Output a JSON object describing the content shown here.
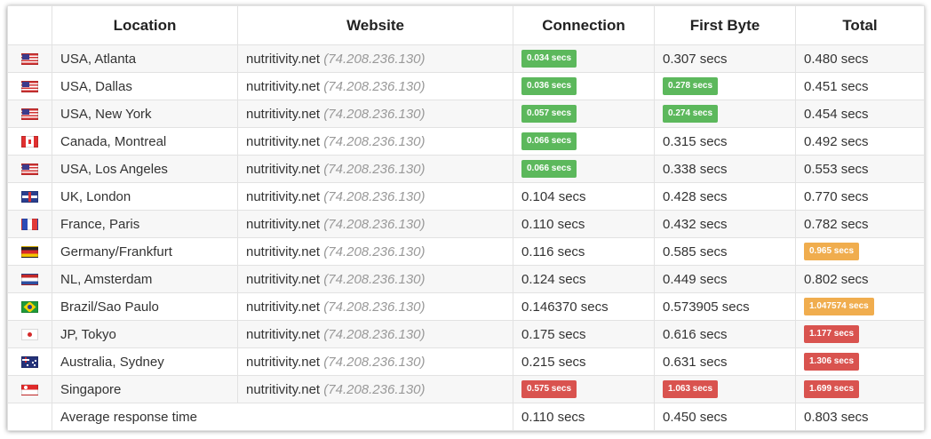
{
  "colors": {
    "green": "#5cb85c",
    "orange": "#f0ad4e",
    "red": "#d9534f"
  },
  "headers": {
    "flag": "",
    "location": "Location",
    "website": "Website",
    "connection": "Connection",
    "first_byte": "First Byte",
    "total": "Total"
  },
  "rows": [
    {
      "flag": "us",
      "flag_icon": "usa-flag-icon",
      "location": "USA, Atlanta",
      "site": "nutritivity.net",
      "ip": "(74.208.236.130)",
      "connection": {
        "value": "0.034 secs",
        "badge": "green"
      },
      "first_byte": {
        "value": "0.307 secs",
        "badge": ""
      },
      "total": {
        "value": "0.480 secs",
        "badge": ""
      }
    },
    {
      "flag": "us",
      "flag_icon": "usa-flag-icon",
      "location": "USA, Dallas",
      "site": "nutritivity.net",
      "ip": "(74.208.236.130)",
      "connection": {
        "value": "0.036 secs",
        "badge": "green"
      },
      "first_byte": {
        "value": "0.278 secs",
        "badge": "green"
      },
      "total": {
        "value": "0.451 secs",
        "badge": ""
      }
    },
    {
      "flag": "us",
      "flag_icon": "usa-flag-icon",
      "location": "USA, New York",
      "site": "nutritivity.net",
      "ip": "(74.208.236.130)",
      "connection": {
        "value": "0.057 secs",
        "badge": "green"
      },
      "first_byte": {
        "value": "0.274 secs",
        "badge": "green"
      },
      "total": {
        "value": "0.454 secs",
        "badge": ""
      }
    },
    {
      "flag": "ca",
      "flag_icon": "canada-flag-icon",
      "location": "Canada, Montreal",
      "site": "nutritivity.net",
      "ip": "(74.208.236.130)",
      "connection": {
        "value": "0.066 secs",
        "badge": "green"
      },
      "first_byte": {
        "value": "0.315 secs",
        "badge": ""
      },
      "total": {
        "value": "0.492 secs",
        "badge": ""
      }
    },
    {
      "flag": "us",
      "flag_icon": "usa-flag-icon",
      "location": "USA, Los Angeles",
      "site": "nutritivity.net",
      "ip": "(74.208.236.130)",
      "connection": {
        "value": "0.066 secs",
        "badge": "green"
      },
      "first_byte": {
        "value": "0.338 secs",
        "badge": ""
      },
      "total": {
        "value": "0.553 secs",
        "badge": ""
      }
    },
    {
      "flag": "gb",
      "flag_icon": "uk-flag-icon",
      "location": "UK, London",
      "site": "nutritivity.net",
      "ip": "(74.208.236.130)",
      "connection": {
        "value": "0.104 secs",
        "badge": ""
      },
      "first_byte": {
        "value": "0.428 secs",
        "badge": ""
      },
      "total": {
        "value": "0.770 secs",
        "badge": ""
      }
    },
    {
      "flag": "fr",
      "flag_icon": "france-flag-icon",
      "location": "France, Paris",
      "site": "nutritivity.net",
      "ip": "(74.208.236.130)",
      "connection": {
        "value": "0.110 secs",
        "badge": ""
      },
      "first_byte": {
        "value": "0.432 secs",
        "badge": ""
      },
      "total": {
        "value": "0.782 secs",
        "badge": ""
      }
    },
    {
      "flag": "de",
      "flag_icon": "germany-flag-icon",
      "location": "Germany/Frankfurt",
      "site": "nutritivity.net",
      "ip": "(74.208.236.130)",
      "connection": {
        "value": "0.116 secs",
        "badge": ""
      },
      "first_byte": {
        "value": "0.585 secs",
        "badge": ""
      },
      "total": {
        "value": "0.965 secs",
        "badge": "orange"
      }
    },
    {
      "flag": "nl",
      "flag_icon": "netherlands-flag-icon",
      "location": "NL, Amsterdam",
      "site": "nutritivity.net",
      "ip": "(74.208.236.130)",
      "connection": {
        "value": "0.124 secs",
        "badge": ""
      },
      "first_byte": {
        "value": "0.449 secs",
        "badge": ""
      },
      "total": {
        "value": "0.802 secs",
        "badge": ""
      }
    },
    {
      "flag": "br",
      "flag_icon": "brazil-flag-icon",
      "location": "Brazil/Sao Paulo",
      "site": "nutritivity.net",
      "ip": "(74.208.236.130)",
      "connection": {
        "value": "0.146370 secs",
        "badge": ""
      },
      "first_byte": {
        "value": "0.573905 secs",
        "badge": ""
      },
      "total": {
        "value": "1.047574 secs",
        "badge": "orange"
      }
    },
    {
      "flag": "jp",
      "flag_icon": "japan-flag-icon",
      "location": "JP, Tokyo",
      "site": "nutritivity.net",
      "ip": "(74.208.236.130)",
      "connection": {
        "value": "0.175 secs",
        "badge": ""
      },
      "first_byte": {
        "value": "0.616 secs",
        "badge": ""
      },
      "total": {
        "value": "1.177 secs",
        "badge": "red"
      }
    },
    {
      "flag": "au",
      "flag_icon": "australia-flag-icon",
      "location": "Australia, Sydney",
      "site": "nutritivity.net",
      "ip": "(74.208.236.130)",
      "connection": {
        "value": "0.215 secs",
        "badge": ""
      },
      "first_byte": {
        "value": "0.631 secs",
        "badge": ""
      },
      "total": {
        "value": "1.306 secs",
        "badge": "red"
      }
    },
    {
      "flag": "sg",
      "flag_icon": "singapore-flag-icon",
      "location": "Singapore",
      "site": "nutritivity.net",
      "ip": "(74.208.236.130)",
      "connection": {
        "value": "0.575 secs",
        "badge": "red"
      },
      "first_byte": {
        "value": "1.063 secs",
        "badge": "red"
      },
      "total": {
        "value": "1.699 secs",
        "badge": "red"
      }
    }
  ],
  "average": {
    "label": "Average response time",
    "connection": "0.110 secs",
    "first_byte": "0.450 secs",
    "total": "0.803 secs"
  }
}
